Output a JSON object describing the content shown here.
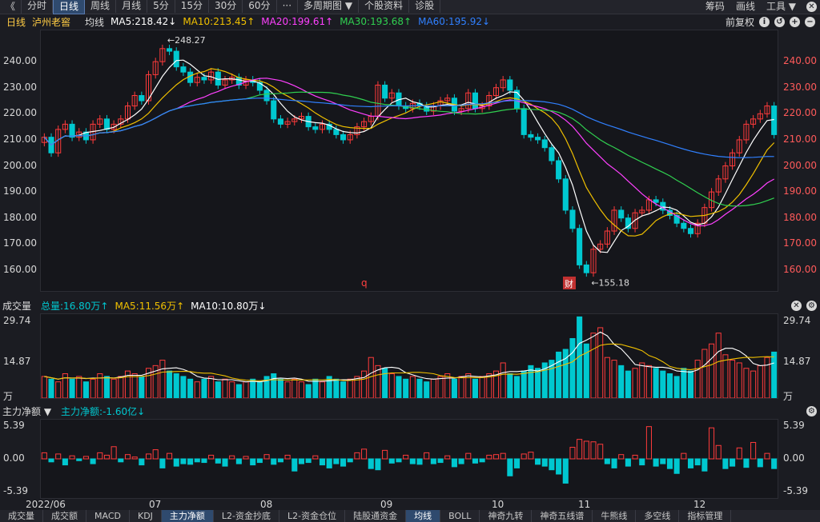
{
  "toolbar": {
    "back": "《",
    "tabs": [
      "分时",
      "日线",
      "周线",
      "月线",
      "5分",
      "15分",
      "30分",
      "60分",
      "···",
      "多周期图 ▼",
      "个股资料",
      "诊股"
    ],
    "active_tab": "日线",
    "right": [
      "筹码",
      "画线",
      "工具 ▼"
    ]
  },
  "info": {
    "period": "日线",
    "stock": "泸州老窖",
    "avg_label": "均线",
    "ma5": "MA5:218.42↓",
    "ma10": "MA10:213.45↑",
    "ma20": "MA20:199.61↑",
    "ma30": "MA30:193.68↑",
    "ma60": "MA60:195.92↓",
    "adjust": "前复权"
  },
  "price_axis": [
    "240.00",
    "230.00",
    "220.00",
    "210.00",
    "200.00",
    "190.00",
    "180.00",
    "170.00",
    "160.00"
  ],
  "price_annotations": {
    "high": "248.27",
    "low": "155.18",
    "marker_q": "q",
    "marker_cai": "财"
  },
  "volume": {
    "title": "成交量",
    "total": "总量:16.80万↑",
    "ma5": "MA5:11.56万↑",
    "ma10": "MA10:10.80万↓",
    "axis": [
      "29.74",
      "14.87",
      "万"
    ]
  },
  "fund": {
    "title": "主力净额 ▼",
    "value": "主力净额:-1.60亿↓",
    "axis": [
      "5.39",
      "0.00",
      "-5.39"
    ]
  },
  "date_axis": [
    "2022/06",
    "07",
    "08",
    "09",
    "10",
    "11",
    "12"
  ],
  "bottom_tabs": [
    "成交量",
    "成交额",
    "MACD",
    "KDJ",
    "主力净额",
    "L2-资金抄底",
    "L2-资金仓位",
    "陆股通资金",
    "均线",
    "BOLL",
    "神奇九转",
    "神奇五线谱",
    "牛熊线",
    "多空线",
    "指标管理"
  ],
  "bottom_active": [
    "主力净额",
    "均线"
  ],
  "colors": {
    "up": "#ff3b3b",
    "down": "#00c8d0",
    "ma5": "#ffffff",
    "ma10": "#f0c000",
    "ma20": "#ff40ff",
    "ma30": "#30d050",
    "ma60": "#3080ff"
  },
  "chart_data": {
    "type": "candlestick",
    "ylim": [
      152,
      252
    ],
    "close": [
      211,
      205,
      214,
      216,
      211,
      213,
      210,
      216,
      218,
      214,
      216,
      218,
      223,
      227,
      225,
      235,
      240,
      245,
      244,
      238,
      236,
      232,
      234,
      233,
      236,
      231,
      233,
      234,
      231,
      233,
      232,
      229,
      225,
      218,
      216,
      217,
      218,
      219,
      215,
      214,
      216,
      214,
      212,
      210,
      212,
      215,
      217,
      219,
      231,
      226,
      228,
      223,
      222,
      224,
      223,
      221,
      223,
      225,
      226,
      221,
      222,
      228,
      222,
      223,
      227,
      230,
      233,
      229,
      222,
      212,
      211,
      210,
      207,
      202,
      195,
      183,
      176,
      162,
      159,
      168,
      170,
      175,
      183,
      180,
      176,
      182,
      183,
      187,
      186,
      183,
      181,
      178,
      176,
      174,
      178,
      184,
      190,
      195,
      200,
      205,
      210,
      216,
      218,
      220,
      223,
      212
    ],
    "volume": [
      8,
      7,
      6,
      9,
      7,
      8,
      6,
      7,
      9,
      8,
      7,
      8,
      10,
      9,
      8,
      11,
      12,
      14,
      10,
      9,
      8,
      7,
      6,
      7,
      8,
      6,
      7,
      6,
      5,
      6,
      7,
      6,
      8,
      9,
      7,
      6,
      7,
      6,
      5,
      7,
      6,
      8,
      7,
      6,
      7,
      8,
      10,
      15,
      12,
      11,
      9,
      8,
      7,
      8,
      7,
      6,
      7,
      8,
      9,
      7,
      8,
      9,
      7,
      8,
      9,
      10,
      13,
      9,
      8,
      10,
      12,
      11,
      13,
      14,
      17,
      18,
      22,
      30,
      20,
      24,
      26,
      15,
      14,
      12,
      10,
      11,
      13,
      12,
      11,
      10,
      9,
      8,
      11,
      10,
      14,
      18,
      20,
      24,
      16,
      14,
      13,
      11,
      10,
      12,
      15,
      17
    ],
    "fund": [
      1,
      -0.5,
      0.8,
      -1,
      0.5,
      -0.3,
      0.4,
      -0.8,
      1,
      0.6,
      2,
      -0.5,
      0.7,
      0.3,
      -1,
      0.8,
      1.5,
      -1.5,
      0.9,
      -1.2,
      -0.8,
      -0.9,
      -0.5,
      -0.6,
      0.6,
      -0.7,
      -1.2,
      0.5,
      -0.8,
      0.4,
      -1,
      -0.6,
      0.7,
      -0.9,
      -0.5,
      0.6,
      -2,
      -0.8,
      -0.6,
      0.5,
      -1,
      -1.5,
      -0.8,
      -1.2,
      -0.5,
      1,
      1.6,
      -1.6,
      -1.8,
      1.4,
      -0.7,
      -0.5,
      0.6,
      -0.8,
      -0.9,
      1,
      -0.8,
      -0.6,
      0.5,
      -1.3,
      -0.8,
      0.9,
      -0.7,
      -0.5,
      0.6,
      0.7,
      0.9,
      -2.8,
      -1.5,
      0.8,
      1.1,
      -0.9,
      -1.2,
      -1.8,
      -2.5,
      -4,
      1.9,
      3.2,
      2.9,
      2.8,
      2.4,
      -0.8,
      -1.5,
      0.7,
      -1.2,
      0.6,
      -1,
      5.3,
      -1.2,
      -0.8,
      -1.6,
      -2.4,
      0.9,
      -1.5,
      -1,
      -2,
      5.1,
      2.2,
      -1.6,
      -1.2,
      1.8,
      -1.4,
      2.7,
      -1.3,
      0.9,
      -1.6
    ]
  }
}
